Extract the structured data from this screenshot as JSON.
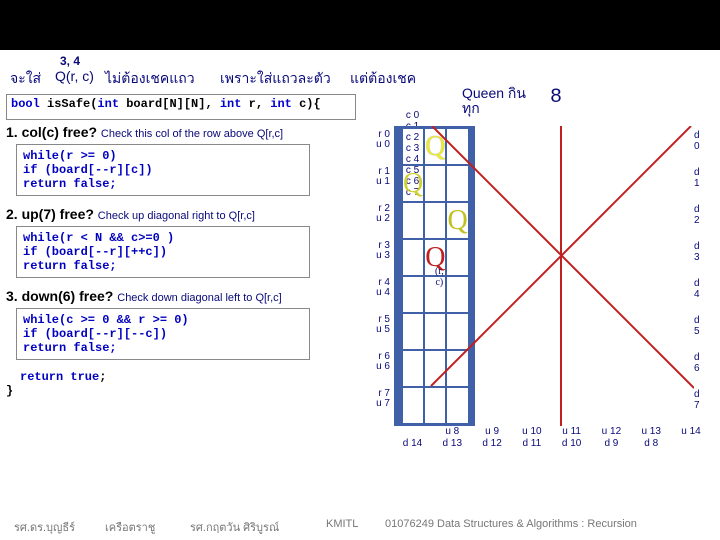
{
  "header": {
    "num": "3, 4",
    "q1": "จะใส่",
    "qrc": "Q(r, c)",
    "q2": "ไม่ต้องเชคแถว",
    "q3": "เพราะใส่แถวละตัว",
    "q4": "แต่ต้องเชค"
  },
  "sig": {
    "pre": "bool",
    "mid": " isSafe(",
    "int1": "int",
    "arg1": " board[N][N], ",
    "int2": "int",
    "arg2": " r, ",
    "int3": "int",
    "arg3": " c){"
  },
  "qnote": {
    "l1": "Queen กิน",
    "l2": "ทุก",
    "num": "8"
  },
  "steps": {
    "s1": {
      "title": "1. col(c) free?",
      "sub": "Check this col of the row above Q[r,c]",
      "c1": "while(r >= 0)",
      "c2": "  if (board[--r][c])",
      "c3": "    return false;"
    },
    "s2": {
      "title": "2. up(7) free?",
      "sub": "Check up diagonal right to Q[r,c]",
      "c1": "while(r < N && c>=0 )",
      "c2": "  if (board[--r][++c])",
      "c3": "    return false;"
    },
    "s3": {
      "title": "3. down(6) free?",
      "sub": "Check down diagonal left to Q[r,c]",
      "c1": "while(c >= 0 && r >= 0)",
      "c2": "  if (board[--r][--c])",
      "c3": "    return false;"
    }
  },
  "ret": {
    "kw": "return true",
    "semi": ";"
  },
  "brace": "}",
  "cols": [
    "c 0",
    "c 1",
    "c 2",
    "c 3",
    "c 4",
    "c 5",
    "c 6",
    "c 7"
  ],
  "rows": [
    {
      "r": "r 0",
      "u": "u 0",
      "d": "d 0"
    },
    {
      "r": "r 1",
      "u": "u 1",
      "d": "d 1"
    },
    {
      "r": "r 2",
      "u": "u 2",
      "d": "d 2"
    },
    {
      "r": "r 3",
      "u": "u 3",
      "d": "d 3"
    },
    {
      "r": "r 4",
      "u": "u 4",
      "d": "d 4"
    },
    {
      "r": "r 5",
      "u": "u 5",
      "d": "d 5"
    },
    {
      "r": "r 6",
      "u": "u 6",
      "d": "d 6"
    },
    {
      "r": "r 7",
      "u": "u 7",
      "d": "d 7"
    }
  ],
  "dbot": [
    {
      "u": "",
      "d": "d 14"
    },
    {
      "u": "u 8",
      "d": "d 13"
    },
    {
      "u": "u 9",
      "d": "d 12"
    },
    {
      "u": "u 10",
      "d": "d 11"
    },
    {
      "u": "u 11",
      "d": "d 10"
    },
    {
      "u": "u 12",
      "d": "d 9"
    },
    {
      "u": "u 13",
      "d": "d 8"
    },
    {
      "u": "u 14",
      "d": ""
    }
  ],
  "queens": {
    "q04": "Q",
    "q13": "Q",
    "q25": "Q",
    "q34": "Q"
  },
  "rc_label": "(r, c)",
  "footer": {
    "a": "รศ.ดร.บุญธีร์",
    "b": "เครือตราชู",
    "c": "รศ.กฤตวัน  ศิริบูรณ์",
    "d": "KMITL",
    "e": "01076249 Data Structures & Algorithms : Recursion"
  }
}
